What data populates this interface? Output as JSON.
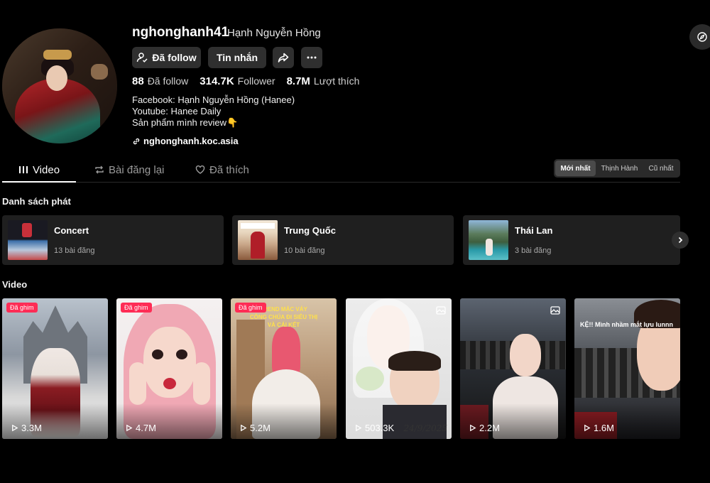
{
  "profile": {
    "username": "nghonghanh41",
    "nickname": "Hạnh Nguyễn Hồng",
    "follow_label": "Đã follow",
    "message_label": "Tin nhắn",
    "stats": [
      {
        "value": "88",
        "label": "Đã follow"
      },
      {
        "value": "314.7K",
        "label": "Follower"
      },
      {
        "value": "8.7M",
        "label": "Lượt thích"
      }
    ],
    "bio": [
      "Facebook: Hạnh Nguyễn Hồng (Hanee)",
      "Youtube: Hanee Daily",
      "Sản phẩm mình review👇"
    ],
    "link": "nghonghanh.koc.asia"
  },
  "tabs": [
    {
      "label": "Video",
      "icon": "grid-icon"
    },
    {
      "label": "Bài đăng lại",
      "icon": "repost-icon"
    },
    {
      "label": "Đã thích",
      "icon": "heart-icon"
    }
  ],
  "sort": {
    "options": [
      "Mới nhất",
      "Thịnh Hành",
      "Cũ nhất"
    ],
    "selected": "Mới nhất"
  },
  "playlists": {
    "title": "Danh sách phát",
    "items": [
      {
        "name": "Concert",
        "count": "13 bài đăng"
      },
      {
        "name": "Trung Quốc",
        "count": "10 bài đăng"
      },
      {
        "name": "Thái Lan",
        "count": "3 bài đăng"
      }
    ]
  },
  "videos": {
    "title": "Video",
    "pin_label": "Đã ghim",
    "items": [
      {
        "views": "3.3M",
        "pinned": true
      },
      {
        "views": "4.7M",
        "pinned": true
      },
      {
        "views": "5.2M",
        "pinned": true,
        "caption_line1": "TREND MẶC VÁY",
        "caption_line2": "CÔNG CHÚA ĐI SIÊU THỊ",
        "caption_line3": "VÀ CÁI KẾT"
      },
      {
        "views": "503.3K",
        "pinned": false,
        "date": "24/9/2025"
      },
      {
        "views": "2.2M",
        "pinned": false
      },
      {
        "views": "1.6M",
        "pinned": false,
        "caption": "KỆ!! Mình nhầm mắt lựu lunnn"
      }
    ]
  },
  "colors": {
    "background": "#000000",
    "button": "#2f2f2f",
    "pin": "#fe2c55",
    "card": "#1f1f1f"
  }
}
